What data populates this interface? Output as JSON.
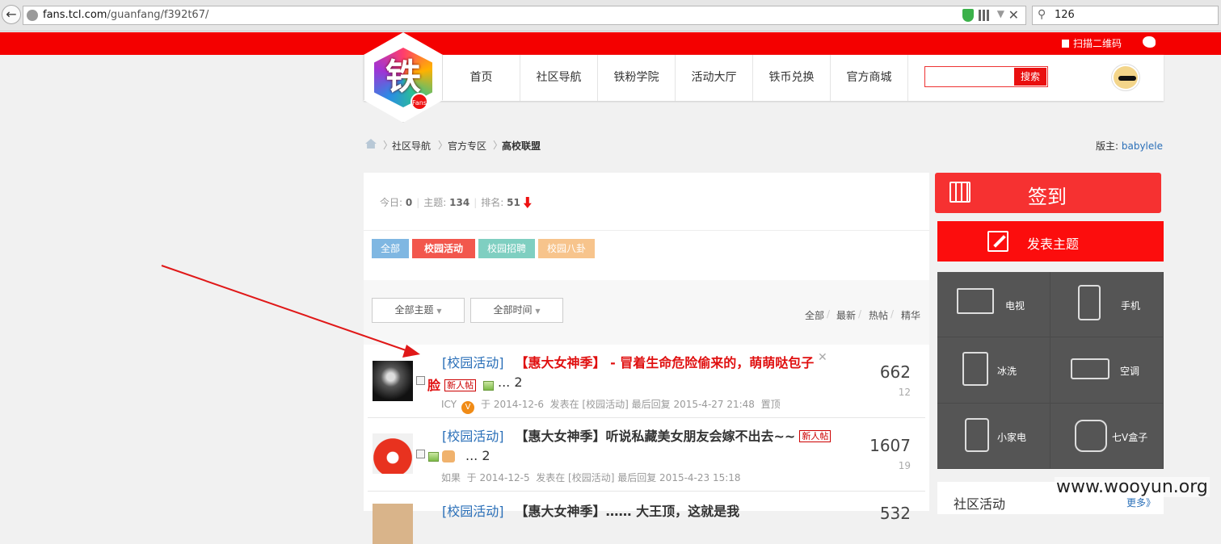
{
  "browser": {
    "url_host": "fans.tcl.com",
    "url_path": "/guanfang/f392t67/",
    "search_value": "126"
  },
  "topbar": {
    "qr_label": "扫描二维码"
  },
  "site": {
    "logo_char": "铁",
    "logo_badge": "Fans",
    "nav": [
      "首页",
      "社区导航",
      "铁粉学院",
      "活动大厅",
      "铁币兑换",
      "官方商城"
    ],
    "search_button": "搜索"
  },
  "breadcrumb": {
    "items": [
      "社区导航",
      "官方专区",
      "高校联盟"
    ],
    "moderator_label": "版主: ",
    "moderator_name": "babylele"
  },
  "forum_stats": {
    "today_label": "今日: ",
    "today": "0",
    "topics_label": "主题: ",
    "topics": "134",
    "rank_label": "排名: ",
    "rank": "51"
  },
  "filter_tabs": [
    {
      "label": "全部",
      "color": "#7fb7e2"
    },
    {
      "label": "校园活动",
      "color": "#f2574d"
    },
    {
      "label": "校园招聘",
      "color": "#7fcfc1"
    },
    {
      "label": "校园八卦",
      "color": "#f7c48c"
    }
  ],
  "dropdowns": {
    "topics": "全部主题",
    "time": "全部时间"
  },
  "sort_links": [
    "全部",
    "最新",
    "热帖",
    "精华"
  ],
  "threads": [
    {
      "category": "[校园活动]",
      "title_line1": "【惠大女神季】 - 冒着生命危险偷来的，萌萌哒包子",
      "title_line2": "脸",
      "new_badge": "新人帖",
      "pages_prefix": "...",
      "pages": "2",
      "author": "ICY",
      "author_badge": "V",
      "posted": "于 2014-12-6",
      "posted_in": "发表在 [校园活动]",
      "last_reply": "最后回复 2015-4-27 21:48",
      "pinned": "置顶",
      "replies": "662",
      "views": "12"
    },
    {
      "category": "[校园活动]",
      "title_line1": "【惠大女神季】听说私藏美女朋友会嫁不出去~~",
      "new_badge": "新人帖",
      "pages_prefix": "...",
      "pages": "2",
      "author": "如果",
      "posted": "于 2014-12-5",
      "posted_in": "发表在 [校园活动]",
      "last_reply": "最后回复 2015-4-23 15:18",
      "replies": "1607",
      "views": "19"
    },
    {
      "category": "[校园活动]",
      "title_partial": "【惠大女神季】…… 大王顶，这就是我",
      "replies_partial": "532"
    }
  ],
  "sidebar": {
    "sign_in": "签到",
    "new_topic": "发表主题",
    "products": [
      "电视",
      "手机",
      "冰洗",
      "空调",
      "小家电",
      "七V盒子"
    ],
    "community_title": "社区活动",
    "community_more": "更多》"
  },
  "watermark": "www.wooyun.org",
  "colors": {
    "brand_red": "#f40000",
    "link_blue": "#2a6fb8",
    "title_red": "#e01010",
    "product_panel": "#555555"
  }
}
